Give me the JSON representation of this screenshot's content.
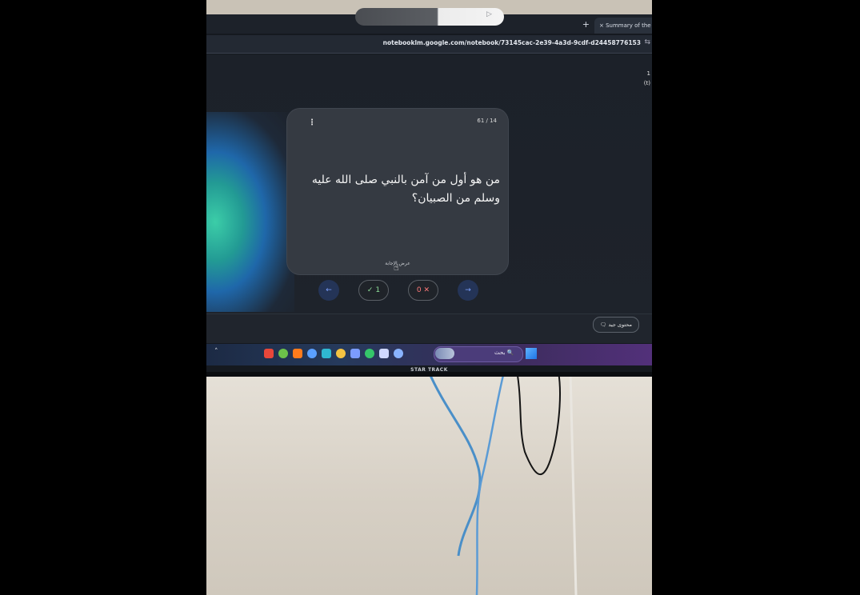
{
  "browser": {
    "new_tab_icon": "+",
    "tab_title": "× Summary of the Prop",
    "url": "notebooklm.google.com/notebook/73145cac-2e39-4a3d-9cdf-d24458776153",
    "url_icon": "⇆"
  },
  "side_indicator": [
    "1",
    "(t)"
  ],
  "flashcard": {
    "menu_icon": "⋮",
    "counter": "61 / 14",
    "question": "من هو أول من آمن بالنبي صلى الله عليه وسلم من الصبيان؟",
    "reveal_label": "عرض الإجابة"
  },
  "controls": {
    "prev_icon": "←",
    "correct_label": "✓ 1",
    "wrong_label": "0 ✕",
    "next_icon": "→"
  },
  "bottom_bar": {
    "save_label": "🗨 محتوى جيد"
  },
  "taskbar": {
    "chevron": "˄",
    "search_label": "بحث 🔍",
    "icons": [
      {
        "name": "app-icon-1",
        "color": "#e8473a"
      },
      {
        "name": "chrome-icon",
        "color": "#6cc24a"
      },
      {
        "name": "firefox-icon",
        "color": "#ff7b1c"
      },
      {
        "name": "app-icon-4",
        "color": "#5aa0ff"
      },
      {
        "name": "edge-icon",
        "color": "#2fb7d1"
      },
      {
        "name": "files-icon",
        "color": "#f5c342"
      },
      {
        "name": "app-icon-7",
        "color": "#7b9cff"
      },
      {
        "name": "whatsapp-icon",
        "color": "#35c66a"
      },
      {
        "name": "app-icon-9",
        "color": "#cfd8ff"
      },
      {
        "name": "app-icon-10",
        "color": "#8ab4ff"
      }
    ]
  },
  "monitor_brand": "STAR TRACK"
}
